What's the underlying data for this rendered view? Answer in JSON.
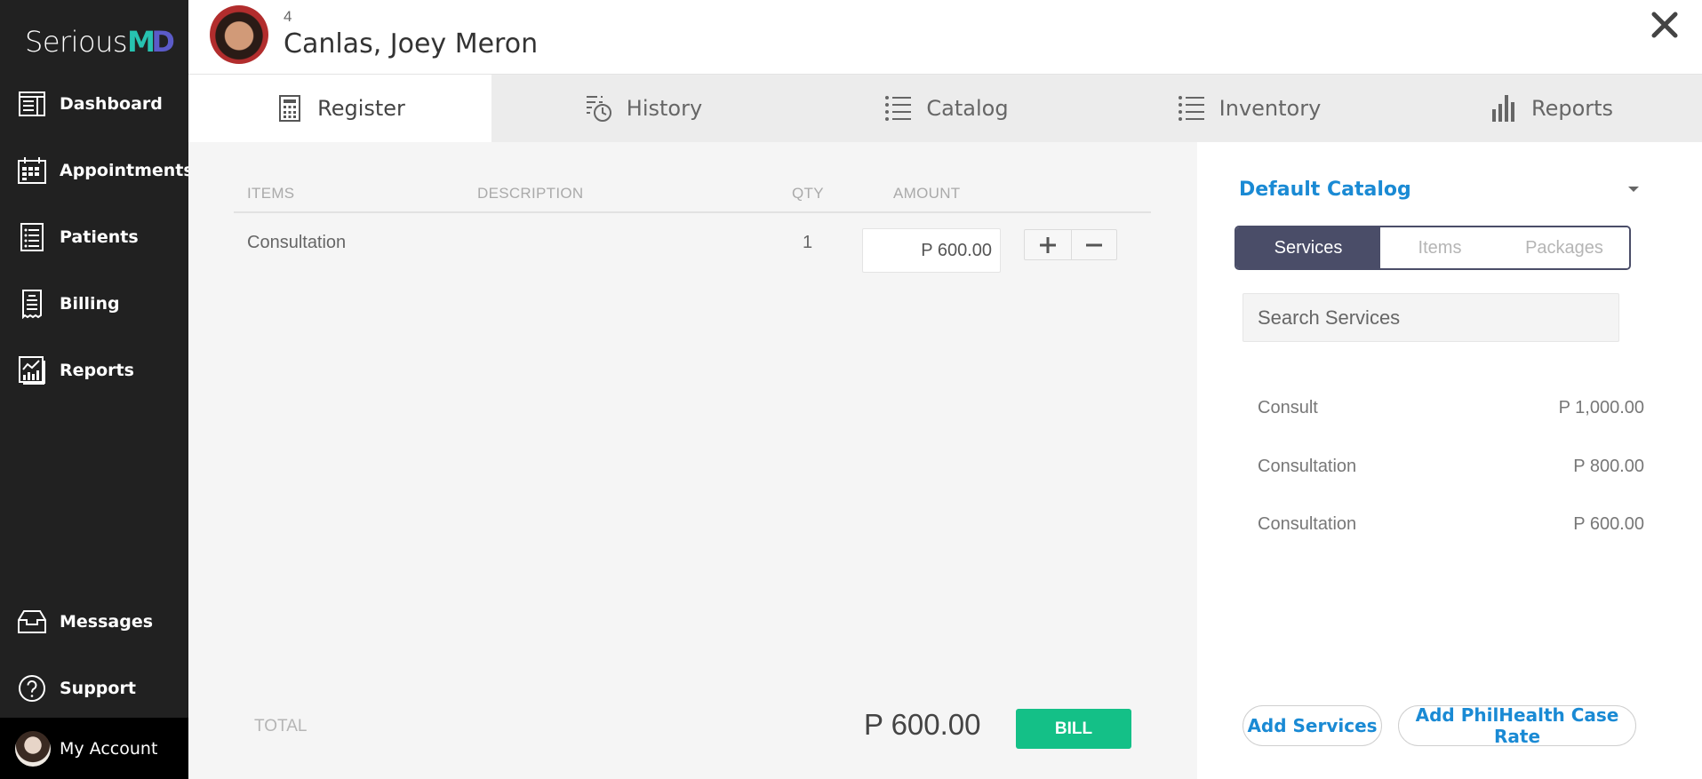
{
  "app": {
    "logo_prefix": "Serious",
    "logo_m": "M",
    "logo_d": "D"
  },
  "sidebar": {
    "items": [
      {
        "label": "Dashboard",
        "icon": "dashboard-icon"
      },
      {
        "label": "Appointments",
        "icon": "calendar-icon"
      },
      {
        "label": "Patients",
        "icon": "list-icon"
      },
      {
        "label": "Billing",
        "icon": "receipt-icon"
      },
      {
        "label": "Reports",
        "icon": "chart-icon"
      }
    ],
    "bottom_items": [
      {
        "label": "Messages",
        "icon": "inbox-icon"
      },
      {
        "label": "Support",
        "icon": "question-icon"
      }
    ],
    "account_label": "My Account"
  },
  "header": {
    "patient_id": "4",
    "patient_name": "Canlas, Joey Meron",
    "close_icon": "close-icon"
  },
  "tabs": [
    {
      "label": "Register",
      "icon": "calculator-icon",
      "active": true
    },
    {
      "label": "History",
      "icon": "history-icon",
      "active": false
    },
    {
      "label": "Catalog",
      "icon": "list-icon",
      "active": false
    },
    {
      "label": "Inventory",
      "icon": "list-icon",
      "active": false
    },
    {
      "label": "Reports",
      "icon": "bar-chart-icon",
      "active": false
    }
  ],
  "register": {
    "columns": [
      "ITEMS",
      "DESCRIPTION",
      "QTY",
      "AMOUNT"
    ],
    "rows": [
      {
        "item": "Consultation",
        "description": "",
        "qty": "1",
        "amount": "P 600.00"
      }
    ],
    "total_label": "TOTAL",
    "total_value": "P 600.00",
    "bill_label": "BILL",
    "bill_color": "#14c087"
  },
  "catalog": {
    "selected_catalog": "Default Catalog",
    "segments": [
      "Services",
      "Items",
      "Packages"
    ],
    "active_segment": "Services",
    "search_placeholder": "Search Services",
    "services": [
      {
        "name": "Consult",
        "price": "P 1,000.00"
      },
      {
        "name": "Consultation",
        "price": "P 800.00"
      },
      {
        "name": "Consultation",
        "price": "P 600.00"
      }
    ],
    "add_services_label": "Add Services",
    "add_philhealth_label": "Add PhilHealth Case Rate",
    "accent_color": "#1a8ad4"
  }
}
